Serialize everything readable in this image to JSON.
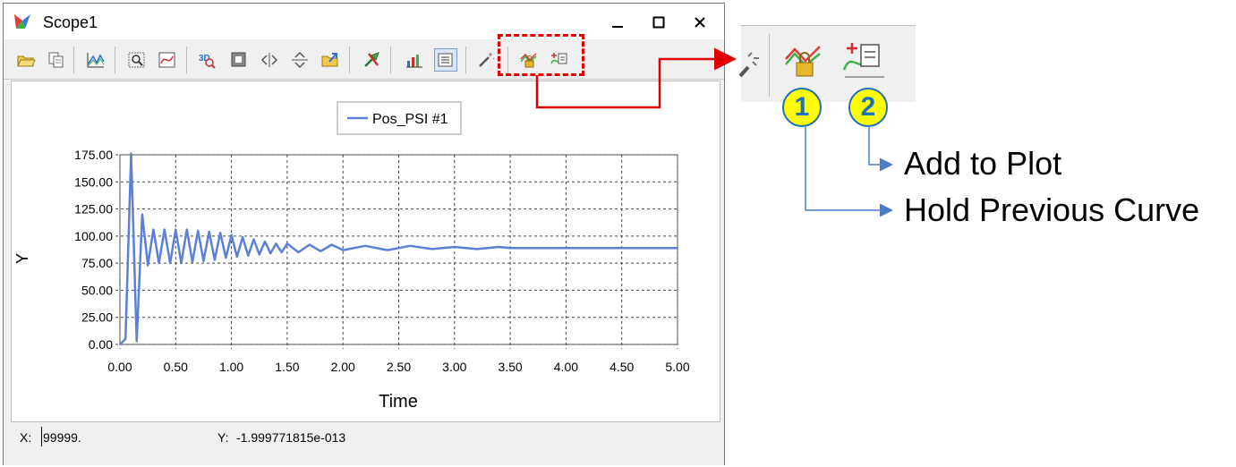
{
  "window": {
    "title": "Scope1"
  },
  "toolbar": {
    "buttons": [
      "open-folder-icon",
      "copy-icon",
      "plot-line-icon",
      "zoom-fit-icon",
      "autoscale-icon",
      "3d-view-icon",
      "fullscreen-icon",
      "horizontal-flip-icon",
      "vertical-flip-icon",
      "export-icon",
      "pointer-cursor-icon",
      "chart-settings-icon",
      "legend-icon",
      "magic-wand-icon",
      "hold-previous-curve-icon",
      "add-to-plot-icon"
    ]
  },
  "legend": {
    "series_name": "Pos_PSI #1"
  },
  "status": {
    "x_label": "X:",
    "x_value": "99999.",
    "y_label": "Y:",
    "y_value": "-1.999771815e-013"
  },
  "callouts": {
    "badge_1": "1",
    "badge_2": "2",
    "add_to_plot": "Add to Plot",
    "hold_previous_curve": "Hold Previous Curve"
  },
  "colors": {
    "series": "#5b80d6",
    "highlight": "#e00000",
    "badge_fill": "#ffff00",
    "badge_text": "#1f6fbf",
    "arrow": "#4a7cc9"
  },
  "chart_data": {
    "type": "line",
    "xlabel": "Time",
    "ylabel": "Y",
    "xlim": [
      0,
      5
    ],
    "ylim": [
      0,
      175
    ],
    "x_ticks": [
      "0.00",
      "0.50",
      "1.00",
      "1.50",
      "2.00",
      "2.50",
      "3.00",
      "3.50",
      "4.00",
      "4.50",
      "5.00"
    ],
    "y_ticks": [
      "0.00",
      "25.00",
      "50.00",
      "75.00",
      "100.00",
      "125.00",
      "150.00",
      "175.00"
    ],
    "grid": true,
    "legend_position": "top-center",
    "series": [
      {
        "name": "Pos_PSI #1",
        "x": [
          0,
          0.05,
          0.1,
          0.15,
          0.2,
          0.25,
          0.3,
          0.35,
          0.4,
          0.45,
          0.5,
          0.55,
          0.6,
          0.65,
          0.7,
          0.75,
          0.8,
          0.85,
          0.9,
          0.95,
          1.0,
          1.05,
          1.1,
          1.15,
          1.2,
          1.25,
          1.3,
          1.35,
          1.4,
          1.45,
          1.5,
          1.6,
          1.7,
          1.8,
          1.9,
          2.0,
          2.2,
          2.4,
          2.6,
          2.8,
          3.0,
          3.2,
          3.4,
          3.5,
          4.0,
          4.5,
          5.0
        ],
        "y": [
          0,
          5,
          176,
          3,
          120,
          73,
          106,
          75,
          106,
          75,
          106,
          75,
          106,
          76,
          105,
          77,
          104,
          78,
          103,
          80,
          101,
          81,
          99,
          82,
          97,
          83,
          95,
          84,
          93,
          85,
          93,
          85,
          92,
          86,
          92,
          87,
          91,
          87,
          91,
          88,
          90,
          88,
          90,
          89,
          89,
          89,
          89
        ]
      }
    ]
  }
}
